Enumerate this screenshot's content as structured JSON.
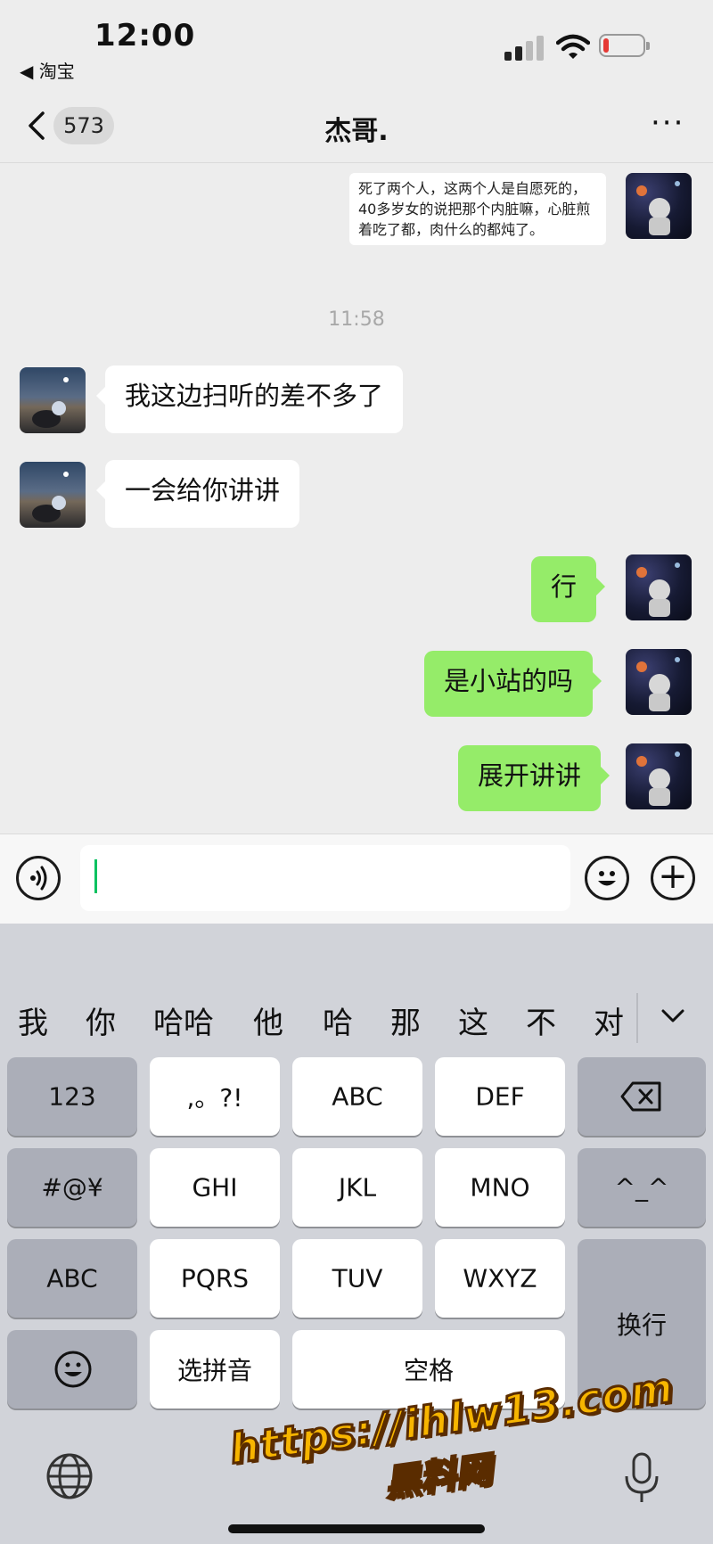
{
  "status_bar": {
    "time": "12:00",
    "back_app": "◀ 淘宝",
    "icons": [
      "cellular-signal-icon",
      "wifi-icon",
      "battery-low-icon"
    ]
  },
  "nav": {
    "unread_count": "573",
    "title": "杰哥.",
    "more_label": "···"
  },
  "messages": [
    {
      "side": "out",
      "type": "quote",
      "text": "死了两个人，这两个人是自愿死的，40多岁女的说把那个内脏嘛，心脏煎着吃了都，肉什么的都炖了。"
    },
    {
      "type": "time",
      "text": "11:58"
    },
    {
      "side": "in",
      "text": "我这边扫听的差不多了"
    },
    {
      "side": "in",
      "text": "一会给你讲讲"
    },
    {
      "side": "out",
      "text": "行"
    },
    {
      "side": "out",
      "text": "是小站的吗"
    },
    {
      "side": "out",
      "text": "展开讲讲"
    }
  ],
  "input": {
    "value": "",
    "placeholder": ""
  },
  "keyboard": {
    "candidates": [
      "我",
      "你",
      "哈哈",
      "他",
      "哈",
      "那",
      "这",
      "不",
      "对"
    ],
    "keys": {
      "num": "123",
      "punct": ",。?!",
      "abc": "ABC",
      "def": "DEF",
      "symbols": "#@¥",
      "ghi": "GHI",
      "jkl": "JKL",
      "mno": "MNO",
      "kaomoji": "^_^",
      "abc_switch": "ABC",
      "pqrs": "PQRS",
      "tuv": "TUV",
      "wxyz": "WXYZ",
      "return": "换行",
      "pinyin": "选拼音",
      "space": "空格"
    }
  },
  "watermark": {
    "url": "https://ihlw13.com",
    "name": "黑料网"
  },
  "colors": {
    "sent_bubble": "#95ec69",
    "received_bubble": "#ffffff",
    "background": "#ededed",
    "caret": "#07c160"
  }
}
